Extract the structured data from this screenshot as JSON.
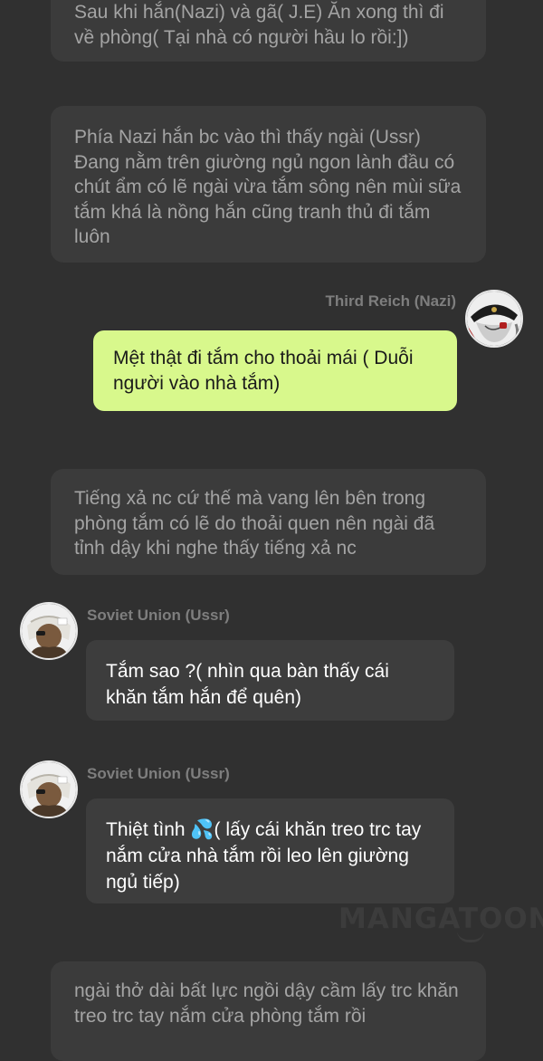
{
  "messages": {
    "narration_1": "Sau khi hắn(Nazi) và gã( J.E) Ăn xong thì đi về phòng( Tại nhà có người hầu lo rồi:])",
    "narration_2": "Phía Nazi hắn bc vào thì thấy ngài (Ussr) Đang nằm trên giường ngủ ngon lành đầu có chút ẩm có lẽ ngài vừa tắm sông nên mùi sữa tắm khá là nồng hắn cũng tranh thủ đi tắm luôn",
    "nazi_name": "Third Reich (Nazi)",
    "nazi_message": "Mệt thật đi tắm cho thoải mái ( Duỗi người vào nhà tắm)",
    "narration_3": "Tiếng xả nc cứ thế mà vang lên bên trong phòng tắm có lẽ do thoải quen nên ngài đã tỉnh dậy khi nghe thấy tiếng xả nc",
    "ussr_name_1": "Soviet Union (Ussr)",
    "ussr_message_1": "Tắm sao ?( nhìn qua bàn thấy cái khăn tắm hắn để quên)",
    "ussr_name_2": "Soviet Union (Ussr)",
    "ussr_message_2_emoji": "💦",
    "ussr_message_2_before": "Thiệt tình ",
    "ussr_message_2_after": "( lấy cái khăn treo trc tay nắm cửa nhà tắm rồi leo lên giường ngủ tiếp)",
    "narration_4": "ngài thở dài bất lực ngồi dậy cầm lấy trc khăn treo trc tay nắm cửa phòng tắm rồi"
  },
  "watermark": "MANGATOON",
  "colors": {
    "background": "#303030",
    "narration_bubble": "#3b3b3b",
    "left_bubble": "#3d3d3d",
    "right_bubble": "#d8f88c"
  },
  "icons": {
    "nazi_avatar": "avatar-image",
    "ussr_avatar": "avatar-image",
    "droplets": "sweat-droplets-emoji"
  }
}
